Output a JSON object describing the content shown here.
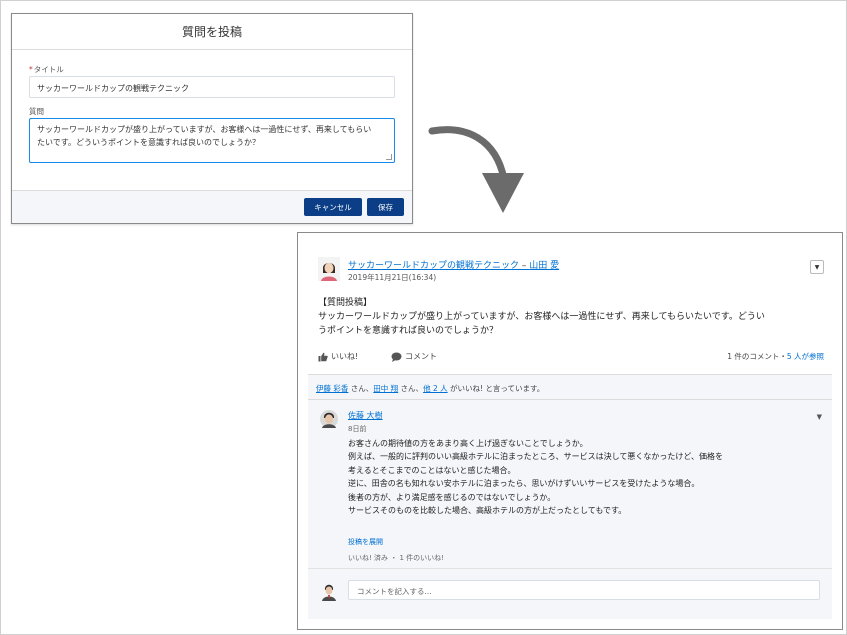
{
  "modal": {
    "title": "質問を投稿",
    "title_label": "タイトル",
    "required_mark": "*",
    "title_value": "サッカーワールドカップの観戦テクニック",
    "question_label": "質問",
    "question_line1": "サッカーワールドカップが盛り上がっていますが、お客様へは一過性にせず、再来してもらい",
    "question_line2": "たいです。どういうポイントを意識すれば良いのでしょうか？",
    "cancel_label": "キャンセル",
    "save_label": "保存"
  },
  "feed": {
    "post_title": "サッカーワールドカップの観戦テクニック",
    "separator": " – ",
    "author": "山田 愛",
    "date": "2019年11月21日(16:34)",
    "menu_glyph": "▼",
    "body_line1": "【質問投稿】",
    "body_line2": "サッカーワールドカップが盛り上がっていますが、お客様へは一過性にせず、再来してもらいたいです。どうい",
    "body_line3": "うポイントを意識すれば良いのでしょうか？",
    "like_label": "いいね!",
    "comment_label": "コメント",
    "counts_prefix": "1 件のコメント・",
    "counts_link": "5 人が参照",
    "likes": {
      "user1": "伊藤 彩香",
      "san1": " さん、",
      "user2": "田中 翔",
      "san2": " さん、",
      "others": "他 2 人",
      "suffix": " がいいね! と言っています。"
    },
    "comment": {
      "author": "佐藤 大樹",
      "time": "8日前",
      "menu_glyph": "▼",
      "lines": [
        "お客さんの期待値の方をあまり高く上げ過ぎないことでしょうか。",
        "例えば、一般的に評判のいい高級ホテルに泊まったところ、サービスは決して悪くなかったけど、価格を",
        "考えるとそこまでのことはないと感じた場合。",
        "逆に、田舎の名も知れない安ホテルに泊まったら、思いがけずいいサービスを受けたような場合。",
        "後者の方が、より満足感を感じるのではないでしょうか。",
        "サービスそのものを比較した場合、高級ホテルの方が上だったとしてもです。"
      ],
      "hide_link": "投稿を展開",
      "meta": "いいね! 済み ・ 1 件のいいね!"
    },
    "comment_placeholder": "コメントを記入する..."
  },
  "colors": {
    "link": "#0070d2",
    "button": "#0b3e86",
    "panel_bg": "#f4f6f9",
    "arrow": "#6b6b6b"
  }
}
